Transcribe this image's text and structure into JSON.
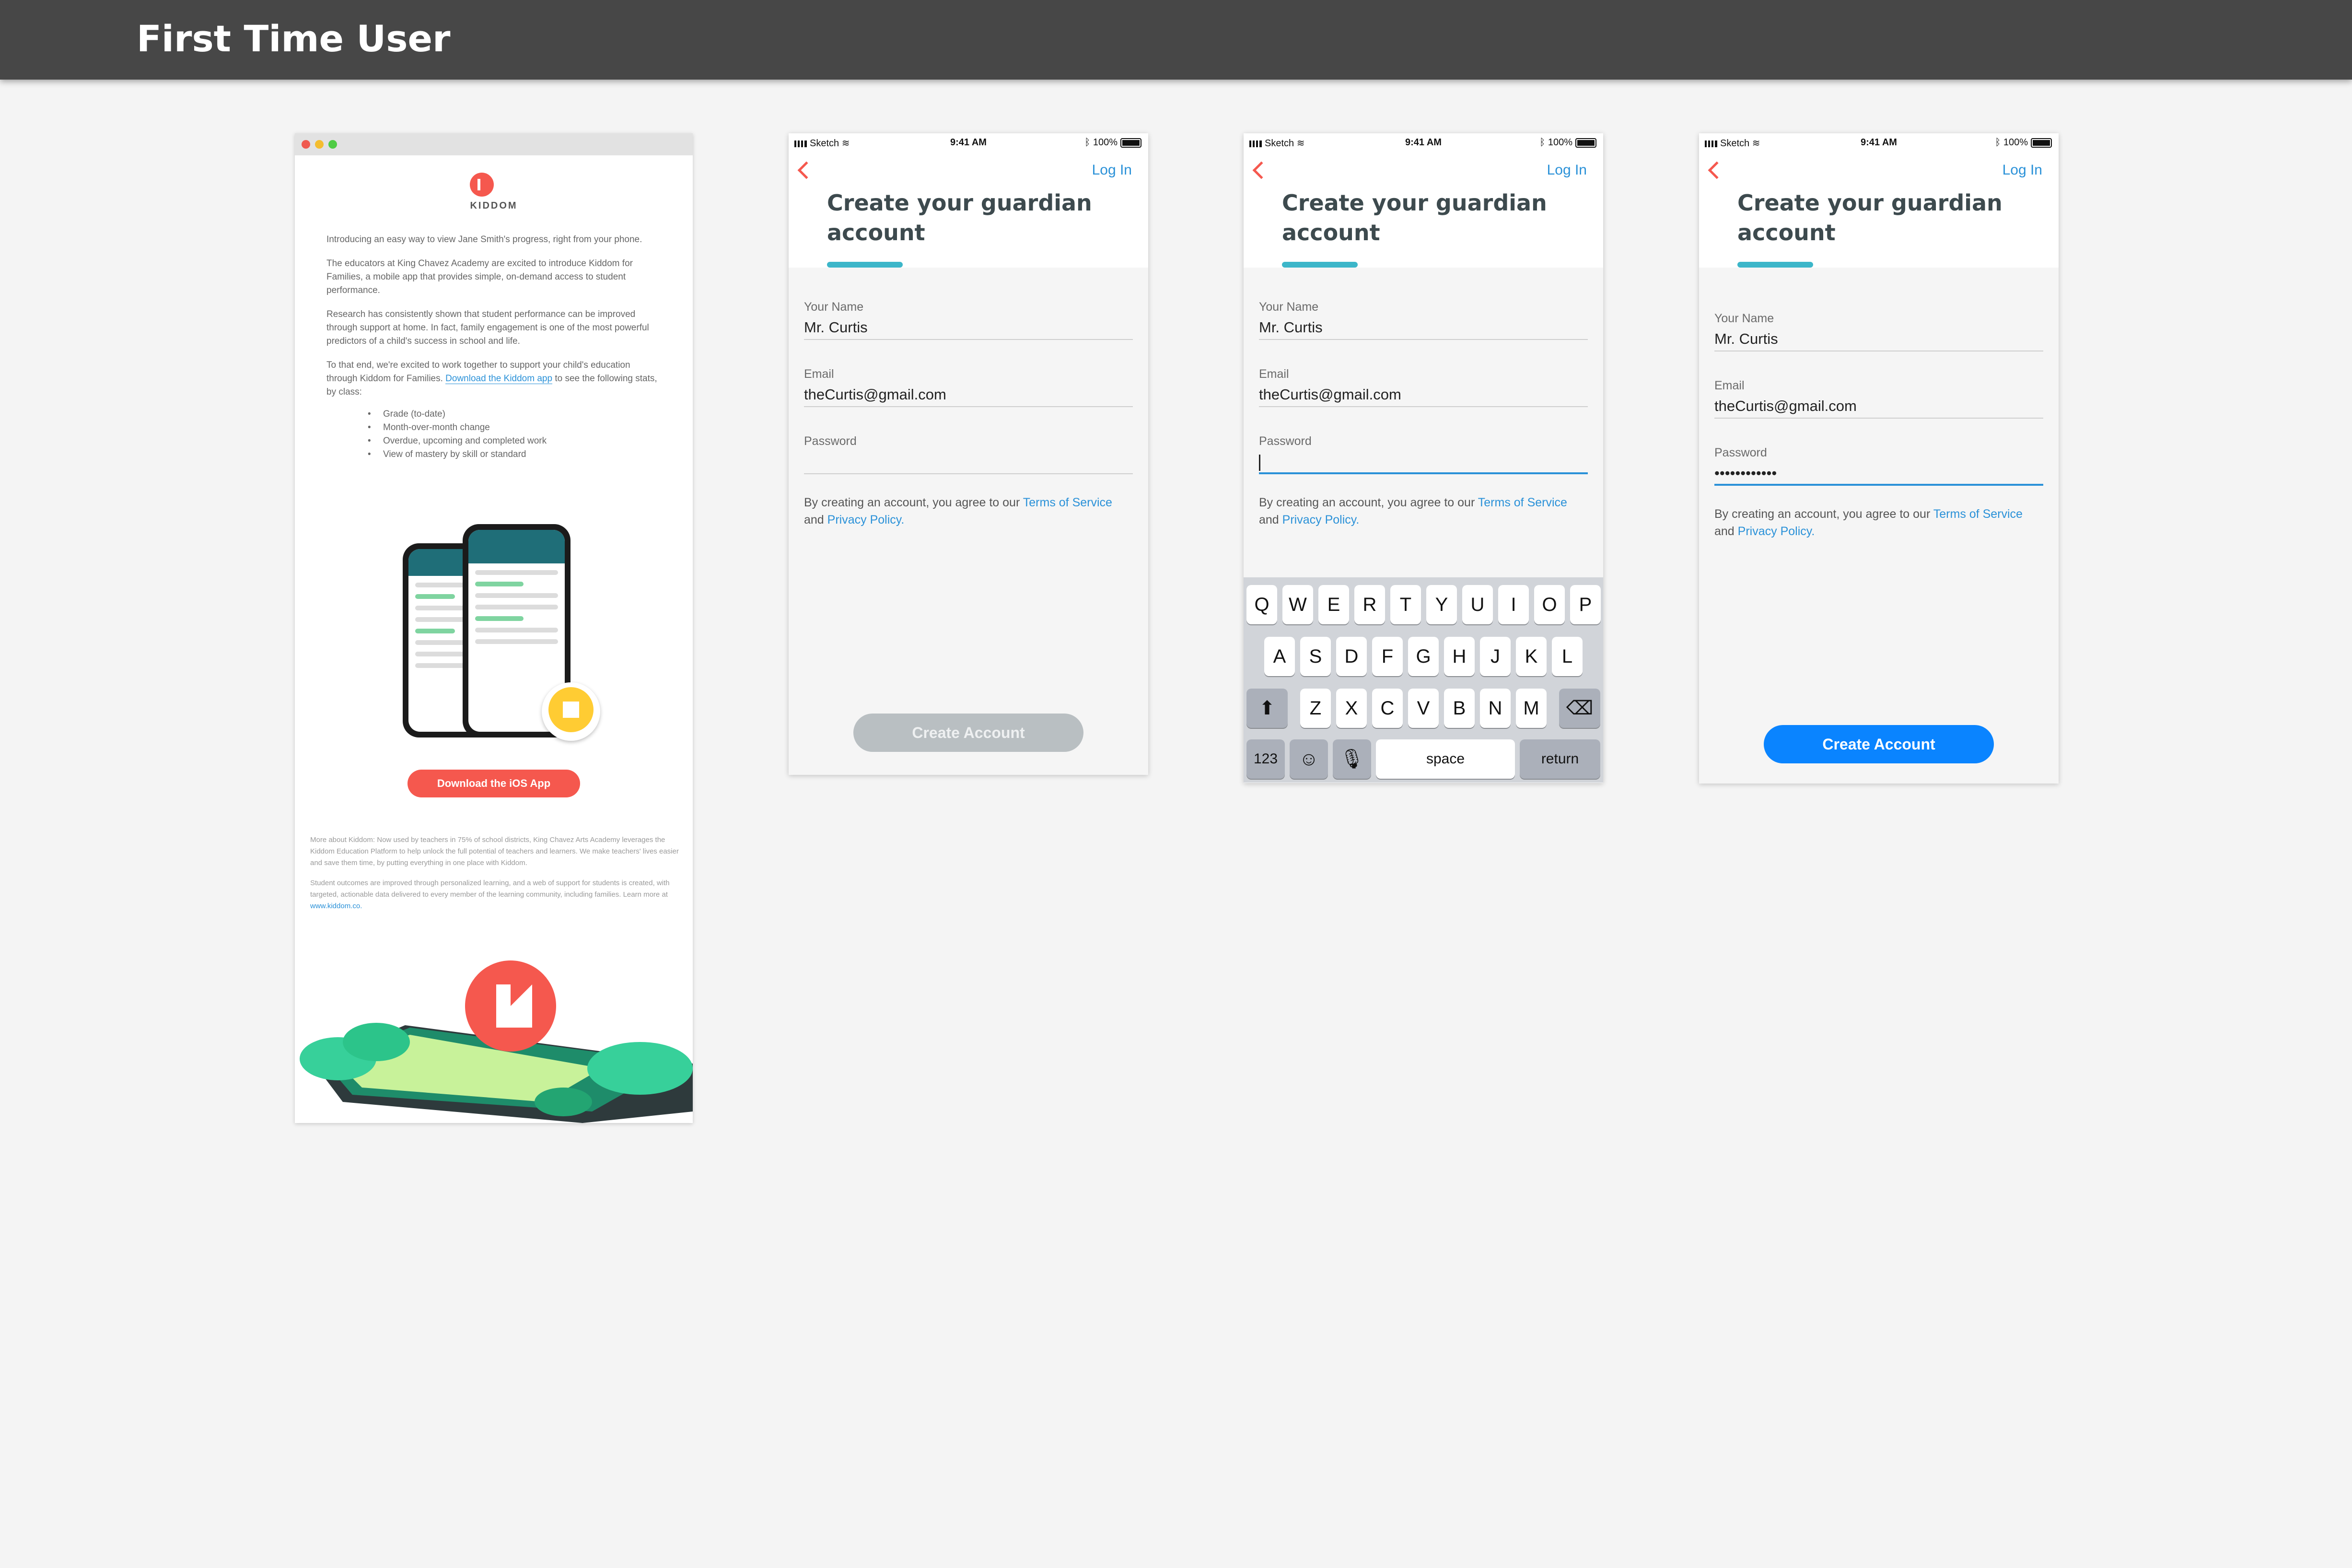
{
  "page_title": "First Time User",
  "email": {
    "brand": "KIDDOM",
    "para1": "Introducing an easy way to view Jane Smith's progress, right from your phone.",
    "para2": "The educators at King Chavez Academy are excited to introduce Kiddom for Families, a mobile app that provides simple, on-demand access to student performance.",
    "para3": "Research has consistently shown that student performance can be improved through support at home. In fact, family engagement is one of the most powerful predictors of a child's success in school and life.",
    "para4_pre": "To that end, we're excited to work together to support your child's education through Kiddom for Families.",
    "para4_link": "Download the Kiddom app",
    "para4_post": "to see the following stats, by class:",
    "bullets": [
      "Grade (to-date)",
      "Month-over-month change",
      "Overdue, upcoming and completed work",
      "View of mastery by skill or standard"
    ],
    "download_button": "Download the iOS App",
    "foot1": "More about Kiddom: Now used by teachers in 75% of school districts, King Chavez Arts Academy leverages the Kiddom Education Platform to help unlock the full potential of teachers and learners. We make teachers' lives easier and save them time, by putting everything in one place with Kiddom.",
    "foot2_pre": "Student outcomes are improved through personalized learning, and a web of support for students is created, with targeted, actionable data delivered to every member of the learning community, including families. Learn more at",
    "foot2_link": "www.kiddom.co."
  },
  "status": {
    "carrier": "Sketch",
    "time": "9:41 AM",
    "battery": "100%"
  },
  "signup": {
    "login": "Log In",
    "heading": "Create your guardian account",
    "name_label": "Your Name",
    "name_value": "Mr. Curtis",
    "email_label": "Email",
    "email_value": "theCurtis@gmail.com",
    "password_label": "Password",
    "password_value": "••••••••••••",
    "terms_pre": "By creating an account, you agree to our",
    "terms_link": "Terms of Service",
    "terms_mid": "and",
    "privacy_link": "Privacy Policy.",
    "create_button": "Create Account"
  },
  "keyboard": {
    "row1": [
      "Q",
      "W",
      "E",
      "R",
      "T",
      "Y",
      "U",
      "I",
      "O",
      "P"
    ],
    "row2": [
      "A",
      "S",
      "D",
      "F",
      "G",
      "H",
      "J",
      "K",
      "L"
    ],
    "row3": [
      "Z",
      "X",
      "C",
      "V",
      "B",
      "N",
      "M"
    ],
    "numbers": "123",
    "space": "space",
    "return": "return"
  },
  "colors": {
    "accent": "#2a91d8",
    "brand": "#f5584e",
    "teal": "#3cb6c9",
    "disabled": "#b9bfc2",
    "active_button": "#0a84ff"
  }
}
